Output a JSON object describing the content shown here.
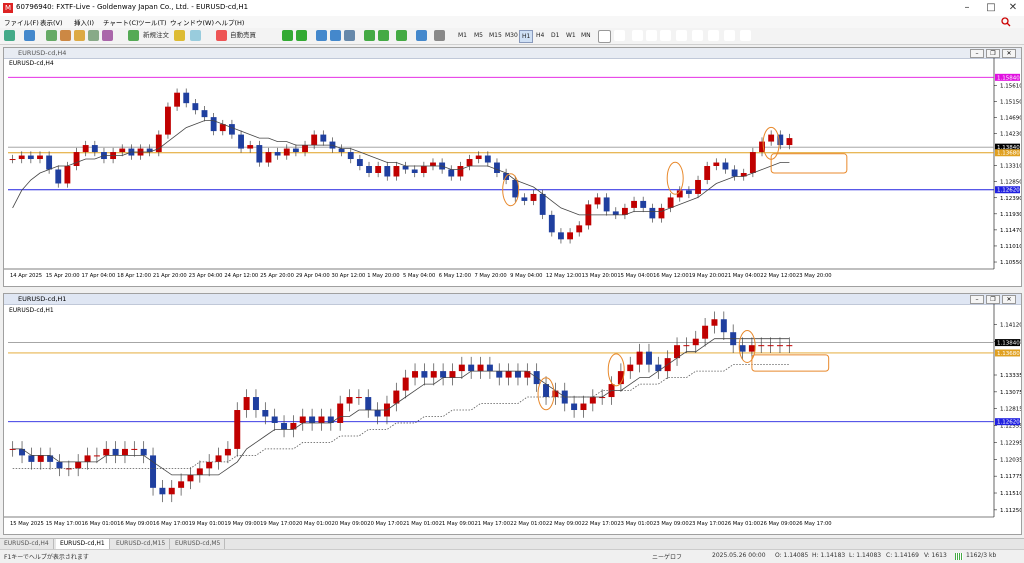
{
  "window": {
    "title": "60796940: FXTF-Live - Goldenway Japan Co., Ltd. - EURUSD-cd,H1",
    "logo": "M"
  },
  "menu": [
    "ファイル(F)",
    "表示(V)",
    "挿入(I)",
    "チャート(C)",
    "ツール(T)",
    "ウィンドウ(W)",
    "ヘルプ(H)"
  ],
  "toolbar": {
    "new_order": "新規注文",
    "auto_trade": "自動売買",
    "timeframes": [
      "M1",
      "M5",
      "M15",
      "M30",
      "H1",
      "H4",
      "D1",
      "W1",
      "MN"
    ],
    "active_timeframe": "H1"
  },
  "chart_top": {
    "title": "EURUSD-cd,H4",
    "symbol_label": "EURUSD-cd,H4",
    "price_labels": [
      {
        "v": 1.1584,
        "t": "1.15840",
        "c": "#e010e0"
      },
      {
        "v": 1.1384,
        "t": "1.13840",
        "c": "#000000"
      },
      {
        "v": 1.1368,
        "t": "1.13680",
        "c": "#e0a020"
      },
      {
        "v": 1.1262,
        "t": "1.12620",
        "c": "#2020e0"
      }
    ],
    "ticks": [
      {
        "v": 1.1561,
        "t": "1.15610"
      },
      {
        "v": 1.1515,
        "t": "1.15150"
      },
      {
        "v": 1.1469,
        "t": "1.14690"
      },
      {
        "v": 1.1423,
        "t": "1.14230"
      },
      {
        "v": 1.1331,
        "t": "1.13310"
      },
      {
        "v": 1.1285,
        "t": "1.12850"
      },
      {
        "v": 1.1239,
        "t": "1.12390"
      },
      {
        "v": 1.1193,
        "t": "1.11930"
      },
      {
        "v": 1.1147,
        "t": "1.11470"
      },
      {
        "v": 1.1101,
        "t": "1.11010"
      },
      {
        "v": 1.1055,
        "t": "1.10550"
      }
    ],
    "ylim": [
      1.1035,
      1.1605
    ],
    "xlabels": [
      "14 Apr 2025",
      "15 Apr 20:00",
      "17 Apr 04:00",
      "18 Apr 12:00",
      "21 Apr 20:00",
      "23 Apr 04:00",
      "24 Apr 12:00",
      "25 Apr 20:00",
      "29 Apr 04:00",
      "30 Apr 12:00",
      "1 May 20:00",
      "5 May 04:00",
      "6 May 12:00",
      "7 May 20:00",
      "9 May 04:00",
      "12 May 12:00",
      "13 May 20:00",
      "15 May 04:00",
      "16 May 12:00",
      "19 May 20:00",
      "21 May 04:00",
      "22 May 12:00",
      "23 May 20:00"
    ],
    "hlines": [
      {
        "v": 1.1584,
        "c": "#e010e0"
      },
      {
        "v": 1.1384,
        "c": "#999999"
      },
      {
        "v": 1.1368,
        "c": "#e0a020"
      },
      {
        "v": 1.1262,
        "c": "#2020e0"
      }
    ],
    "closes": [
      1.135,
      1.136,
      1.135,
      1.136,
      1.132,
      1.128,
      1.133,
      1.137,
      1.139,
      1.137,
      1.135,
      1.137,
      1.138,
      1.136,
      1.138,
      1.137,
      1.142,
      1.15,
      1.154,
      1.151,
      1.149,
      1.147,
      1.143,
      1.145,
      1.142,
      1.138,
      1.139,
      1.134,
      1.137,
      1.136,
      1.138,
      1.137,
      1.139,
      1.142,
      1.14,
      1.138,
      1.137,
      1.135,
      1.133,
      1.131,
      1.133,
      1.13,
      1.133,
      1.132,
      1.131,
      1.133,
      1.134,
      1.132,
      1.13,
      1.133,
      1.135,
      1.136,
      1.134,
      1.131,
      1.129,
      1.124,
      1.123,
      1.125,
      1.119,
      1.114,
      1.112,
      1.114,
      1.116,
      1.122,
      1.124,
      1.12,
      1.119,
      1.121,
      1.123,
      1.121,
      1.118,
      1.121,
      1.124,
      1.126,
      1.125,
      1.129,
      1.133,
      1.134,
      1.132,
      1.13,
      1.131,
      1.137,
      1.14,
      1.142,
      1.139,
      1.141
    ],
    "ma": [
      1.121,
      1.126,
      1.129,
      1.131,
      1.132,
      1.133,
      1.133,
      1.134,
      1.135,
      1.135,
      1.136,
      1.136,
      1.136,
      1.137,
      1.137,
      1.137,
      1.138,
      1.14,
      1.142,
      1.144,
      1.145,
      1.146,
      1.146,
      1.145,
      1.144,
      1.143,
      1.142,
      1.141,
      1.141,
      1.14,
      1.14,
      1.139,
      1.139,
      1.139,
      1.139,
      1.139,
      1.138,
      1.138,
      1.137,
      1.136,
      1.135,
      1.134,
      1.134,
      1.133,
      1.133,
      1.133,
      1.133,
      1.133,
      1.132,
      1.132,
      1.133,
      1.133,
      1.133,
      1.132,
      1.131,
      1.129,
      1.128,
      1.127,
      1.125,
      1.123,
      1.121,
      1.12,
      1.119,
      1.119,
      1.119,
      1.119,
      1.119,
      1.119,
      1.12,
      1.12,
      1.12,
      1.12,
      1.121,
      1.122,
      1.123,
      1.124,
      1.126,
      1.128,
      1.129,
      1.13,
      1.13,
      1.131,
      1.132,
      1.133,
      1.134,
      1.134
    ],
    "ellipses": [
      {
        "i": 54.5,
        "v": 1.1262
      },
      {
        "i": 72.5,
        "v": 1.1295
      },
      {
        "i": 83,
        "v": 1.1395
      }
    ],
    "boxes": [
      {
        "i0": 83,
        "i1": 88,
        "v0": 1.1365,
        "v1": 1.131
      }
    ]
  },
  "chart_bottom": {
    "title": "EURUSD-cd,H1",
    "symbol_label": "EURUSD-cd,H1",
    "price_labels": [
      {
        "v": 1.1384,
        "t": "1.13840",
        "c": "#000000"
      },
      {
        "v": 1.1368,
        "t": "1.13680",
        "c": "#e0a020"
      },
      {
        "v": 1.1262,
        "t": "1.12620",
        "c": "#2020e0"
      }
    ],
    "ticks": [
      {
        "v": 1.1412,
        "t": "1.14120"
      },
      {
        "v": 1.1386,
        "t": "1.13860"
      },
      {
        "v": 1.1334,
        "t": "1.13335"
      },
      {
        "v": 1.1308,
        "t": "1.13075"
      },
      {
        "v": 1.1282,
        "t": "1.12815"
      },
      {
        "v": 1.1256,
        "t": "1.12555"
      },
      {
        "v": 1.123,
        "t": "1.12295"
      },
      {
        "v": 1.1204,
        "t": "1.12035"
      },
      {
        "v": 1.1178,
        "t": "1.11775"
      },
      {
        "v": 1.1152,
        "t": "1.11510"
      },
      {
        "v": 1.1126,
        "t": "1.11250"
      }
    ],
    "ylim": [
      1.1115,
      1.1425
    ],
    "xlabels": [
      "15 May 2025",
      "15 May 17:00",
      "16 May 01:00",
      "16 May 09:00",
      "16 May 17:00",
      "19 May 01:00",
      "19 May 09:00",
      "19 May 17:00",
      "20 May 01:00",
      "20 May 09:00",
      "20 May 17:00",
      "21 May 01:00",
      "21 May 09:00",
      "21 May 17:00",
      "22 May 01:00",
      "22 May 09:00",
      "22 May 17:00",
      "23 May 01:00",
      "23 May 09:00",
      "23 May 17:00",
      "26 May 01:00",
      "26 May 09:00",
      "26 May 17:00"
    ],
    "hlines": [
      {
        "v": 1.1384,
        "c": "#999999"
      },
      {
        "v": 1.1368,
        "c": "#e0a020"
      },
      {
        "v": 1.1262,
        "c": "#2020e0"
      }
    ],
    "closes": [
      1.122,
      1.121,
      1.12,
      1.121,
      1.12,
      1.119,
      1.119,
      1.12,
      1.121,
      1.121,
      1.122,
      1.121,
      1.122,
      1.122,
      1.121,
      1.116,
      1.115,
      1.116,
      1.117,
      1.118,
      1.119,
      1.12,
      1.121,
      1.122,
      1.128,
      1.13,
      1.128,
      1.127,
      1.126,
      1.125,
      1.126,
      1.127,
      1.126,
      1.127,
      1.126,
      1.129,
      1.13,
      1.13,
      1.128,
      1.127,
      1.129,
      1.131,
      1.133,
      1.134,
      1.133,
      1.134,
      1.133,
      1.134,
      1.135,
      1.134,
      1.135,
      1.134,
      1.133,
      1.134,
      1.133,
      1.134,
      1.132,
      1.13,
      1.131,
      1.129,
      1.128,
      1.129,
      1.13,
      1.13,
      1.132,
      1.134,
      1.135,
      1.137,
      1.135,
      1.134,
      1.136,
      1.138,
      1.138,
      1.139,
      1.141,
      1.142,
      1.14,
      1.138,
      1.137,
      1.138,
      1.138,
      1.138,
      1.138,
      1.138
    ],
    "ma": [
      1.122,
      1.122,
      1.121,
      1.121,
      1.121,
      1.12,
      1.12,
      1.12,
      1.12,
      1.12,
      1.121,
      1.121,
      1.121,
      1.121,
      1.121,
      1.12,
      1.119,
      1.118,
      1.118,
      1.118,
      1.118,
      1.118,
      1.118,
      1.119,
      1.12,
      1.122,
      1.123,
      1.124,
      1.125,
      1.125,
      1.125,
      1.126,
      1.126,
      1.126,
      1.126,
      1.127,
      1.127,
      1.128,
      1.128,
      1.128,
      1.128,
      1.129,
      1.13,
      1.131,
      1.132,
      1.132,
      1.133,
      1.133,
      1.133,
      1.134,
      1.134,
      1.134,
      1.134,
      1.134,
      1.134,
      1.134,
      1.133,
      1.132,
      1.131,
      1.13,
      1.13,
      1.13,
      1.13,
      1.13,
      1.131,
      1.131,
      1.132,
      1.133,
      1.133,
      1.134,
      1.135,
      1.136,
      1.137,
      1.137,
      1.138,
      1.139,
      1.139,
      1.139,
      1.139,
      1.139,
      1.139,
      1.139,
      1.139,
      1.139
    ],
    "ma2": [
      1.119,
      1.119,
      1.119,
      1.119,
      1.119,
      1.119,
      1.119,
      1.119,
      1.119,
      1.119,
      1.119,
      1.119,
      1.119,
      1.119,
      1.119,
      1.119,
      1.119,
      1.119,
      1.119,
      1.119,
      1.12,
      1.12,
      1.12,
      1.12,
      1.121,
      1.121,
      1.121,
      1.122,
      1.122,
      1.122,
      1.122,
      1.123,
      1.123,
      1.123,
      1.123,
      1.124,
      1.124,
      1.124,
      1.125,
      1.125,
      1.125,
      1.126,
      1.126,
      1.126,
      1.127,
      1.127,
      1.127,
      1.128,
      1.128,
      1.128,
      1.129,
      1.129,
      1.129,
      1.129,
      1.129,
      1.13,
      1.13,
      1.13,
      1.13,
      1.13,
      1.13,
      1.13,
      1.13,
      1.131,
      1.131,
      1.131,
      1.131,
      1.132,
      1.132,
      1.132,
      1.133,
      1.133,
      1.133,
      1.134,
      1.134,
      1.134,
      1.134,
      1.135,
      1.135,
      1.135,
      1.135,
      1.135,
      1.135,
      1.135
    ],
    "ellipses": [
      {
        "i": 57,
        "v": 1.1305
      },
      {
        "i": 64.5,
        "v": 1.1342
      },
      {
        "i": 78.5,
        "v": 1.1378
      }
    ],
    "boxes": [
      {
        "i0": 79,
        "i1": 84,
        "v0": 1.1365,
        "v1": 1.134
      }
    ]
  },
  "tabs": [
    {
      "label": "EURUSD-cd,H4",
      "active": false
    },
    {
      "label": "EURUSD-cd,H1",
      "active": true
    },
    {
      "label": "EURUSD-cd,M15",
      "active": false
    },
    {
      "label": "EURUSD-cd,M5",
      "active": false
    }
  ],
  "status": {
    "help": "F1キーでヘルプが表示されます",
    "profile": "ニーゲロフ",
    "datetime": "2025.05.26 00:00",
    "open": "O: 1.14085",
    "high": "H: 1.14183",
    "low": "L: 1.14083",
    "close": "C: 1.14169",
    "volume": "V: 1613",
    "traffic": "1162/3 kb"
  }
}
